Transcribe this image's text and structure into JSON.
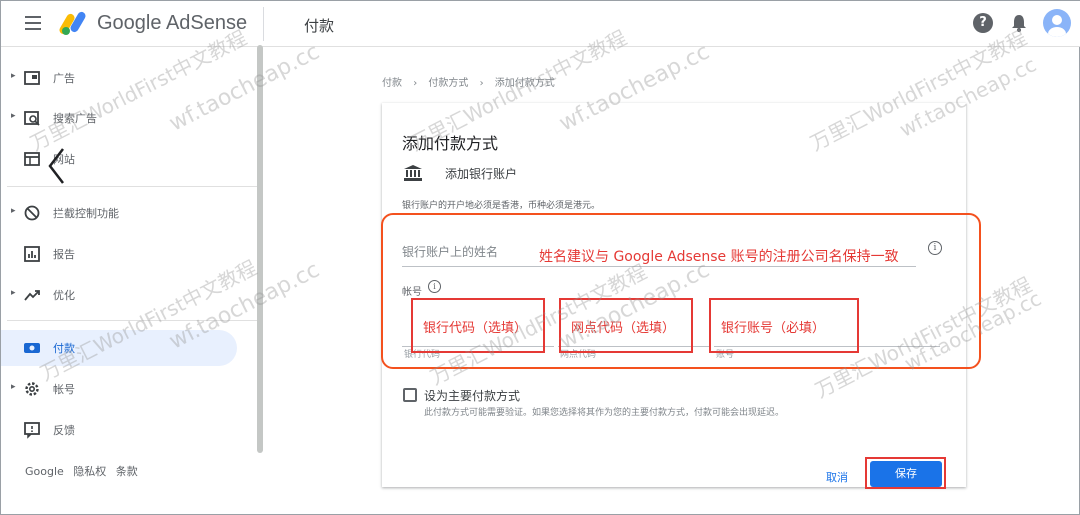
{
  "header": {
    "brand": "Google AdSense",
    "page_title": "付款",
    "help_label": "?"
  },
  "sidebar": {
    "items": [
      {
        "label": "广告",
        "icon": "ad-icon",
        "caret": true
      },
      {
        "label": "搜索广告",
        "icon": "search-ads-icon",
        "caret": true
      },
      {
        "label": "网站",
        "icon": "sites-icon",
        "caret": false
      },
      {
        "label": "拦截控制功能",
        "icon": "block-icon",
        "caret": true
      },
      {
        "label": "报告",
        "icon": "reports-icon",
        "caret": false
      },
      {
        "label": "优化",
        "icon": "optimize-icon",
        "caret": true
      },
      {
        "label": "付款",
        "icon": "payments-icon",
        "caret": false,
        "active": true
      },
      {
        "label": "帐号",
        "icon": "account-icon",
        "caret": true
      },
      {
        "label": "反馈",
        "icon": "feedback-icon",
        "caret": false
      }
    ],
    "footer": {
      "google": "Google",
      "privacy": "隐私权",
      "terms": "条款"
    }
  },
  "breadcrumb": [
    "付款",
    "›",
    "付款方式",
    "›",
    "添加付款方式"
  ],
  "card": {
    "title": "添加付款方式",
    "section_title": "添加银行账户",
    "note": "银行账户的开户地必须是香港，币种必须是港元。",
    "name_field_label": "银行账户上的姓名",
    "account_label": "帐号",
    "info_glyph": "i",
    "fields": {
      "bank_code": "银行代码",
      "branch_code": "网点代码",
      "account_no": "账号"
    },
    "primary_label": "设为主要付款方式",
    "primary_note": "此付款方式可能需要验证。如果您选择将其作为您的主要付款方式，付款可能会出现延迟。",
    "cancel": "取消",
    "save": "保存"
  },
  "annotations": {
    "name_hint": "姓名建议与 Google Adsense 账号的注册公司名保持一致",
    "bank_code": "银行代码（选填）",
    "branch_code": "网点代码（选填）",
    "account_no": "银行账号（必填）"
  },
  "watermark": {
    "text1": "万里汇WorldFirst中文教程",
    "text2": "wf.taocheap.cc"
  },
  "colors": {
    "accent": "#1a73e8",
    "annotation_red": "#e53935",
    "annotation_orange": "#f4511e"
  }
}
